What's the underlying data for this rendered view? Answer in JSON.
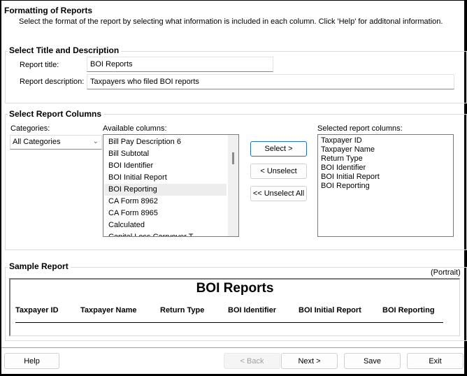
{
  "header": {
    "title": "Formatting of Reports",
    "subtitle": "Select the format of the report by selecting what information is included in each column. Click 'Help' for additonal information."
  },
  "title_section": {
    "label": "Select Title and Description",
    "report_title_label": "Report title:",
    "report_title_value": "BOI Reports",
    "report_description_label": "Report description:",
    "report_description_value": "Taxpayers who filed BOI reports"
  },
  "columns_section": {
    "label": "Select Report Columns",
    "categories_label": "Categories:",
    "categories_selected": "All Categories",
    "available_label": "Available columns:",
    "available_columns": [
      "Bill Pay Description 6",
      "Bill Subtotal",
      "BOI Identifier",
      "BOI Initial Report",
      "BOI Reporting",
      "CA Form 8962",
      "CA Form 8965",
      "Calculated",
      "Capital Loss Carryover T"
    ],
    "highlighted_index": 4,
    "select_button": "Select >",
    "unselect_button": "< Unselect",
    "unselect_all_button": "<< Unselect All",
    "selected_label": "Selected report columns:",
    "selected_columns": [
      "Taxpayer ID",
      "Taxpayer Name",
      "Return Type",
      "BOI Identifier",
      "BOI Initial Report",
      "BOI Reporting"
    ]
  },
  "sample_section": {
    "label": "Sample Report",
    "orientation": "(Portrait)",
    "report_title": "BOI Reports",
    "columns": [
      "Taxpayer ID",
      "Taxpayer Name",
      "Return Type",
      "BOI Identifier",
      "BOI Initial Report",
      "BOI Reporting"
    ]
  },
  "footer": {
    "help": "Help",
    "back": "< Back",
    "next": "Next >",
    "save": "Save",
    "exit": "Exit"
  }
}
